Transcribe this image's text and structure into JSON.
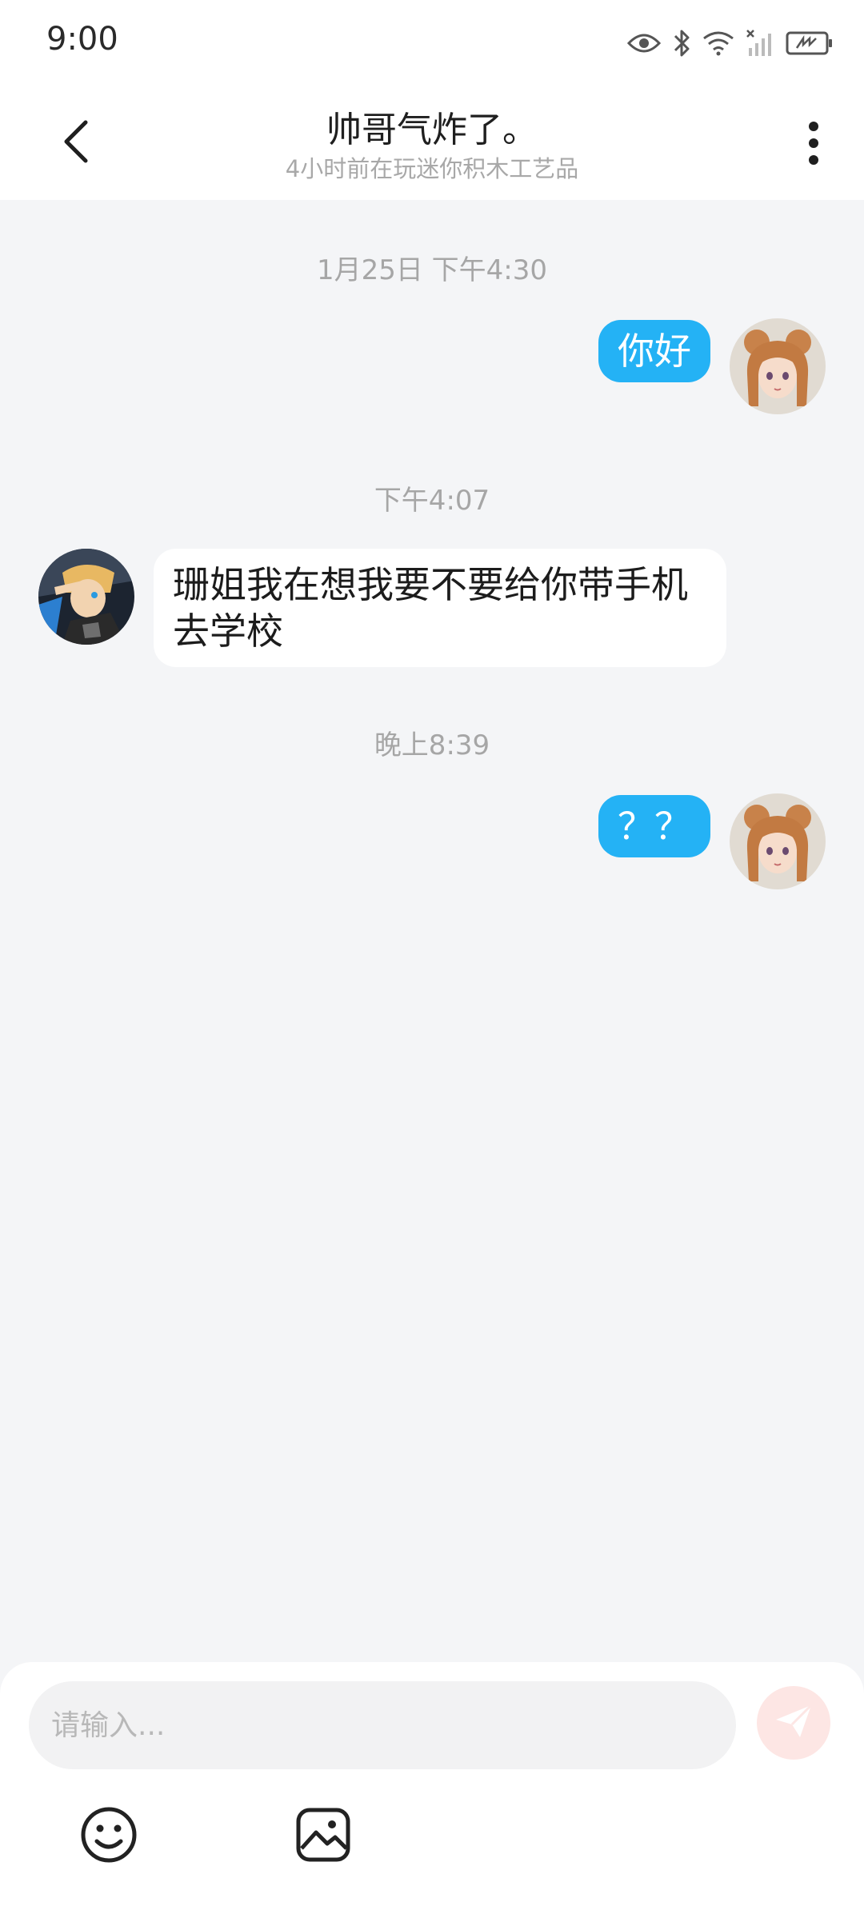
{
  "status_bar": {
    "time": "9:00",
    "icons": [
      "eye-icon",
      "bluetooth-icon",
      "wifi-icon",
      "cellular-signal-icon",
      "battery-icon"
    ]
  },
  "header": {
    "title": "帅哥气炸了。",
    "subtitle": "4小时前在玩迷你积木工艺品",
    "back_icon": "chevron-left-icon",
    "more_icon": "more-vertical-icon"
  },
  "messages": [
    {
      "type": "timestamp",
      "text": "1月25日 下午4:30"
    },
    {
      "type": "sent",
      "text": "你好"
    },
    {
      "type": "timestamp",
      "text": "下午4:07"
    },
    {
      "type": "received",
      "text": "珊姐我在想我要不要给你带手机去学校"
    },
    {
      "type": "timestamp",
      "text": "晚上8:39"
    },
    {
      "type": "sent",
      "text": "？？"
    }
  ],
  "input": {
    "placeholder": "请输入...",
    "value": ""
  },
  "toolbar": {
    "send_icon": "send-icon",
    "emoji_icon": "emoji-icon",
    "image_icon": "image-icon"
  },
  "colors": {
    "sent_bubble": "#24b2f5",
    "received_bubble": "#ffffff",
    "chat_background": "#f4f5f7",
    "send_button_bg": "#fde6e4",
    "send_button_icon": "#ffffff"
  }
}
